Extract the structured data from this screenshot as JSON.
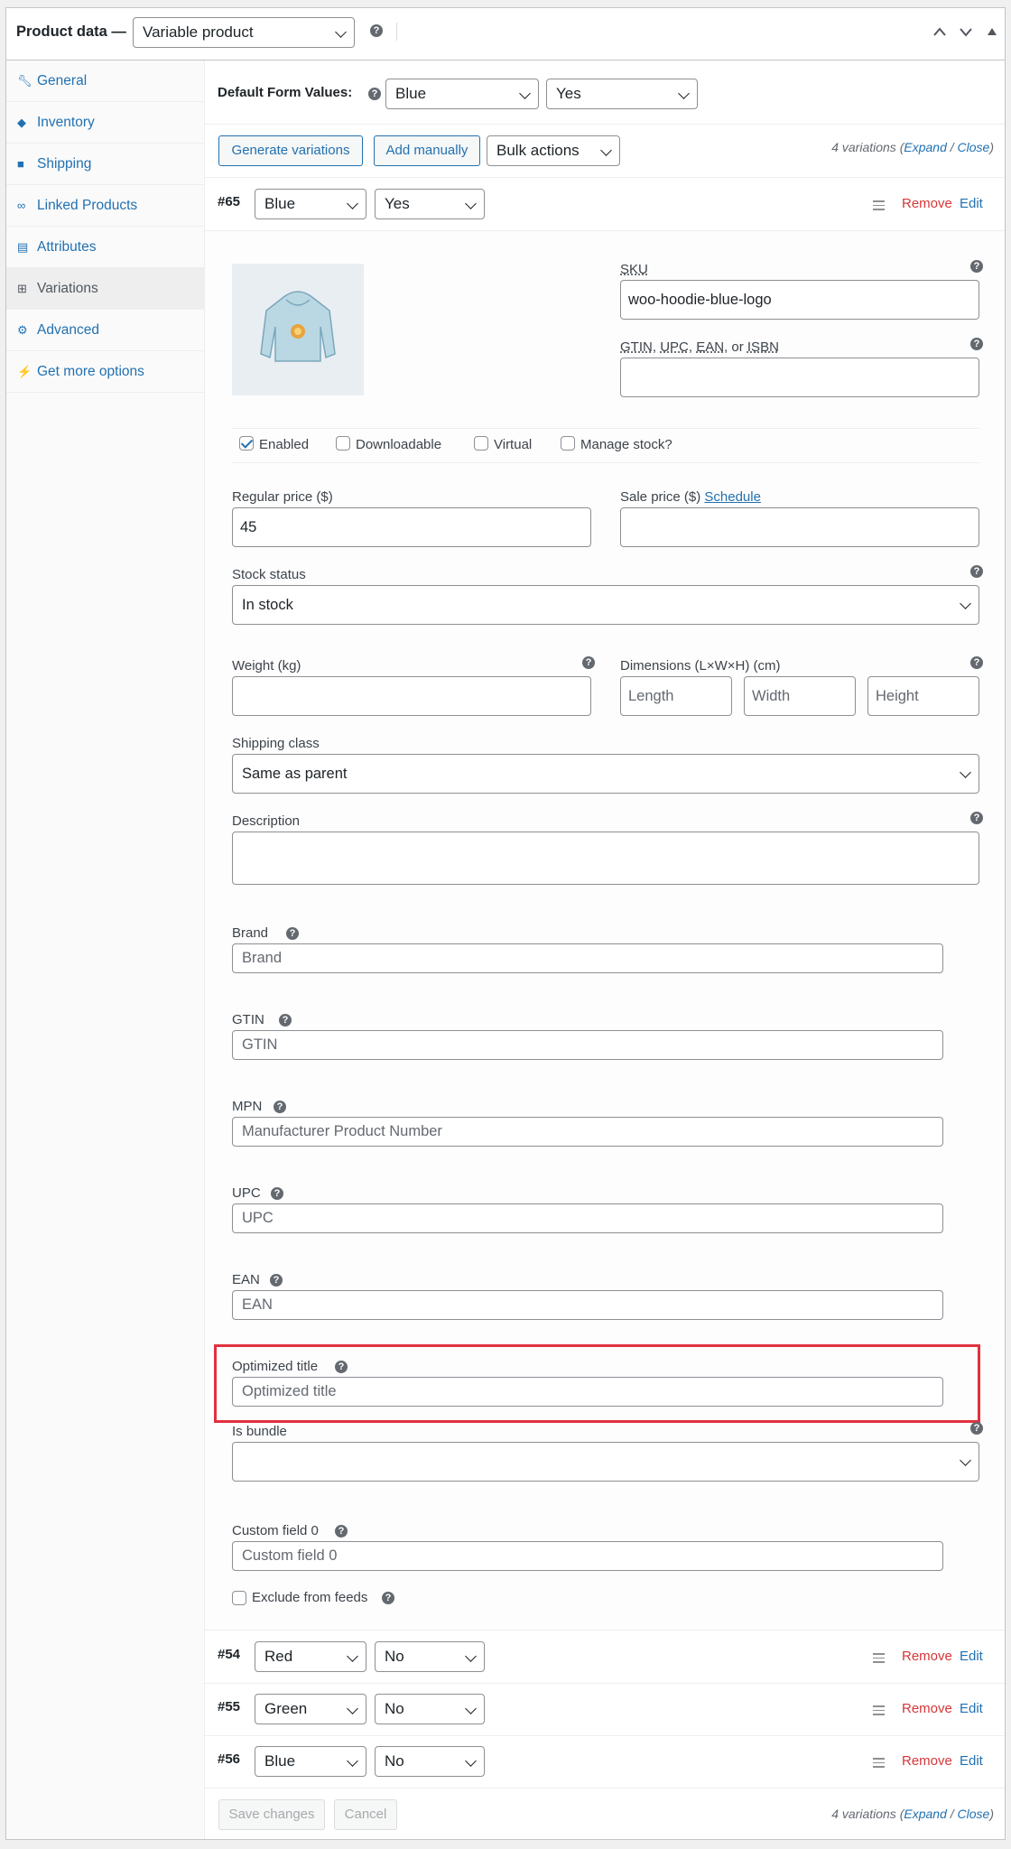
{
  "header": {
    "title": "Product data —",
    "product_type": "Variable product"
  },
  "sidebar": {
    "items": [
      {
        "label": "General",
        "icon": "wrench-icon"
      },
      {
        "label": "Inventory",
        "icon": "tag-icon"
      },
      {
        "label": "Shipping",
        "icon": "truck-icon"
      },
      {
        "label": "Linked Products",
        "icon": "link-icon"
      },
      {
        "label": "Attributes",
        "icon": "list-icon"
      },
      {
        "label": "Variations",
        "icon": "grid-icon"
      },
      {
        "label": "Advanced",
        "icon": "gear-icon"
      },
      {
        "label": "Get more options",
        "icon": "plug-icon"
      }
    ]
  },
  "defaults": {
    "label": "Default Form Values:",
    "color": "Blue",
    "logo": "Yes"
  },
  "toolbar": {
    "generate": "Generate variations",
    "add_manually": "Add manually",
    "bulk": "Bulk actions",
    "count": "4 variations",
    "expand": "Expand",
    "sep": "/",
    "close": "Close"
  },
  "variation": {
    "id": "#65",
    "color": "Blue",
    "logo": "Yes",
    "remove": "Remove",
    "edit": "Edit",
    "sku_label": "SKU",
    "sku_value": "woo-hoodie-blue-logo",
    "gtin_label_parts": [
      "GTIN",
      ", ",
      "UPC",
      ", ",
      "EAN",
      ", or ",
      "ISBN"
    ],
    "enabled": "Enabled",
    "downloadable": "Downloadable",
    "virtual": "Virtual",
    "manage_stock": "Manage stock?",
    "regular_price_label": "Regular price ($)",
    "regular_price": "45",
    "sale_price_label": "Sale price ($)",
    "schedule": "Schedule",
    "stock_status_label": "Stock status",
    "stock_status": "In stock",
    "weight_label": "Weight (kg)",
    "dimensions_label": "Dimensions (L×W×H) (cm)",
    "length_ph": "Length",
    "width_ph": "Width",
    "height_ph": "Height",
    "shipping_class_label": "Shipping class",
    "shipping_class": "Same as parent",
    "description_label": "Description",
    "brand_label": "Brand",
    "brand_ph": "Brand",
    "gtin_label": "GTIN",
    "gtin_ph": "GTIN",
    "mpn_label": "MPN",
    "mpn_ph": "Manufacturer Product Number",
    "upc_label": "UPC",
    "upc_ph": "UPC",
    "ean_label": "EAN",
    "ean_ph": "EAN",
    "opt_title_label": "Optimized title",
    "opt_title_ph": "Optimized title",
    "is_bundle_label": "Is bundle",
    "is_bundle": "",
    "custom0_label": "Custom field 0",
    "custom0_ph": "Custom field 0",
    "exclude_label": "Exclude from feeds"
  },
  "other_variations": [
    {
      "id": "#54",
      "color": "Red",
      "logo": "No"
    },
    {
      "id": "#55",
      "color": "Green",
      "logo": "No"
    },
    {
      "id": "#56",
      "color": "Blue",
      "logo": "No"
    }
  ],
  "footer": {
    "save": "Save changes",
    "cancel": "Cancel",
    "count": "4 variations",
    "expand": "Expand",
    "sep": "/",
    "close": "Close"
  },
  "colors": {
    "link": "#2271b1",
    "remove": "#d63638",
    "highlight": "#e0313f"
  }
}
